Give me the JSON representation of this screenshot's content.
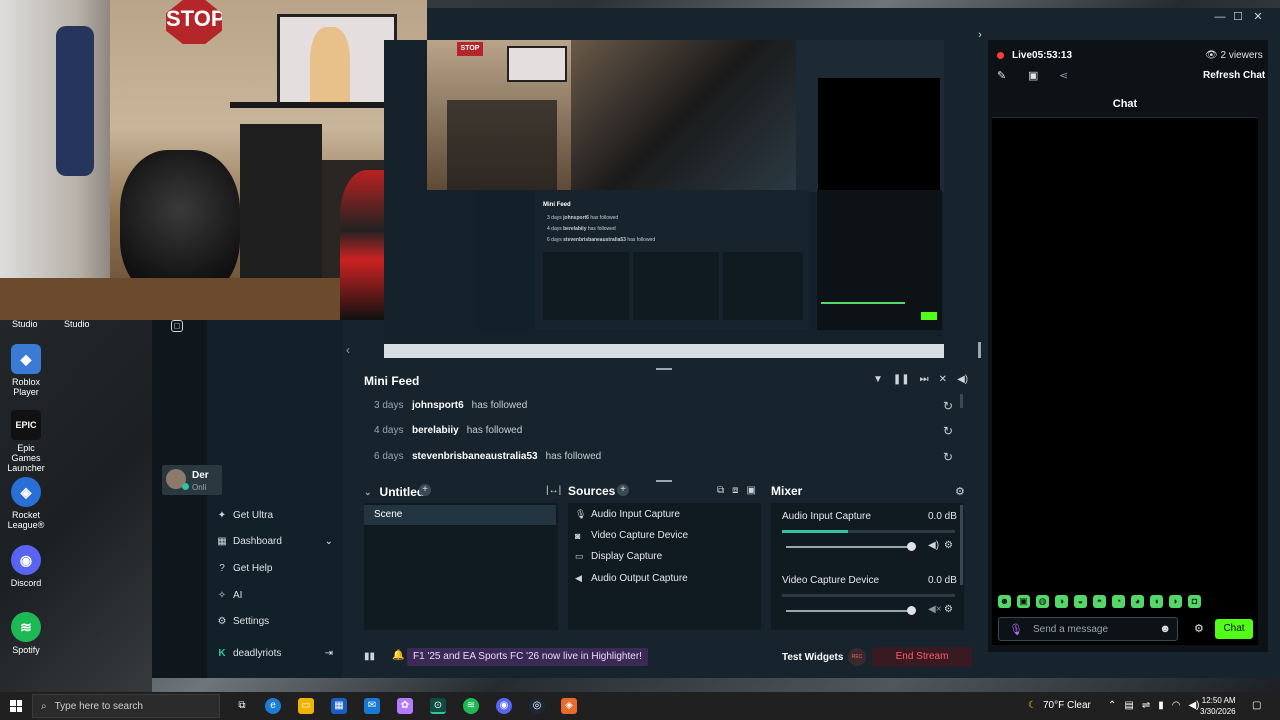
{
  "desktop": {
    "webcam_labels": [
      "Studio",
      "Studio"
    ],
    "icons": [
      {
        "name": "roblox-player-icon",
        "label": "Roblox Player",
        "color": "#3a7bd5",
        "glyph": "◆"
      },
      {
        "name": "epic-games-icon",
        "label": "Epic Games Launcher",
        "color": "#111111",
        "glyph": "EPIC"
      },
      {
        "name": "rocket-league-icon",
        "label": "Rocket League®",
        "color": "#2a6fd6",
        "glyph": "◈"
      },
      {
        "name": "discord-icon",
        "label": "Discord",
        "color": "#5865f2",
        "glyph": "◉"
      },
      {
        "name": "spotify-icon",
        "label": "Spotify",
        "color": "#1db954",
        "glyph": "≋"
      }
    ]
  },
  "webcam": {
    "sign": "STOP"
  },
  "window": {
    "minimize": "—",
    "maximize": "☐",
    "close": "✕"
  },
  "user_card": {
    "name": "Der",
    "status": "Onli"
  },
  "nav": {
    "items": [
      {
        "label": "Get Ultra",
        "icon": "ultra-icon",
        "glyph": "✦"
      },
      {
        "label": "Dashboard",
        "icon": "dashboard-icon",
        "glyph": "▦"
      },
      {
        "label": "Get Help",
        "icon": "help-icon",
        "glyph": "?"
      },
      {
        "label": "AI",
        "icon": "ai-icon",
        "glyph": "✧"
      },
      {
        "label": "Settings",
        "icon": "gear-icon",
        "glyph": "⚙"
      }
    ],
    "account": "deadlyriots",
    "dashboard_chevron": "⌄"
  },
  "chat": {
    "live_label": "Live",
    "live_time": "05:53:13",
    "viewers": "2 viewers",
    "refresh": "Refresh Chat",
    "title": "Chat",
    "input_placeholder": "Send a message",
    "send_label": "Chat",
    "emotes": [
      "☻",
      "▣",
      "◍",
      "◑",
      "◒",
      "◓",
      "◔",
      "◕",
      "◖",
      "◗",
      "◘"
    ]
  },
  "mini_feed": {
    "title": "Mini Feed",
    "rows": [
      {
        "ago": "3 days",
        "user": "johnsport6",
        "action": "has followed"
      },
      {
        "ago": "4 days",
        "user": "berelabiiy",
        "action": "has followed"
      },
      {
        "ago": "6 days",
        "user": "stevenbrisbaneaustralia53",
        "action": "has followed"
      }
    ]
  },
  "scenes": {
    "title": "Untitled",
    "items": [
      "Scene"
    ]
  },
  "sources": {
    "title": "Sources",
    "items": [
      {
        "label": "Audio Input Capture",
        "icon": "microphone-icon",
        "glyph": "🎙"
      },
      {
        "label": "Video Capture Device",
        "icon": "camera-icon",
        "glyph": "◙"
      },
      {
        "label": "Display Capture",
        "icon": "monitor-icon",
        "glyph": "▭"
      },
      {
        "label": "Audio Output Capture",
        "icon": "speaker-icon",
        "glyph": "◀"
      }
    ]
  },
  "mixer": {
    "title": "Mixer",
    "channels": [
      {
        "name": "Audio Input Capture",
        "db": "0.0 dB",
        "level": 0.38
      },
      {
        "name": "Video Capture Device",
        "db": "0.0 dB",
        "level": 0.0
      }
    ]
  },
  "footer": {
    "notice": "F1 '25 and EA Sports FC '26 now live in Highlighter!",
    "test_widgets": "Test Widgets",
    "rec": "REC",
    "end_stream": "End Stream"
  },
  "taskbar": {
    "search_placeholder": "Type here to search",
    "weather": "70°F  Clear",
    "time": "12:50 AM",
    "date": "3/30/2026"
  },
  "preview_feed": {
    "title": "Mini Feed",
    "rows": [
      {
        "ago": "3 days",
        "user": "johnsport6",
        "action": "has followed"
      },
      {
        "ago": "4 days",
        "user": "berelabiiy",
        "action": "has followed"
      },
      {
        "ago": "6 days",
        "user": "stevenbrisbaneaustralia53",
        "action": "has followed"
      }
    ]
  }
}
